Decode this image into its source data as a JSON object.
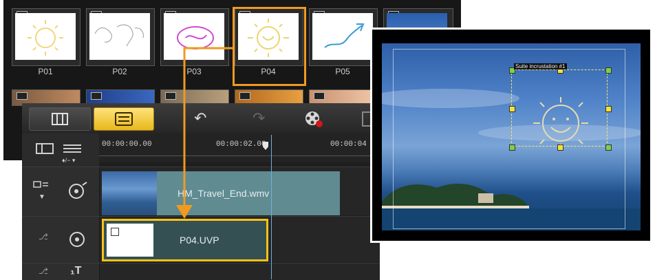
{
  "library": {
    "thumbs": [
      {
        "label": "P01"
      },
      {
        "label": "P02"
      },
      {
        "label": "P03"
      },
      {
        "label": "P04"
      },
      {
        "label": "P05"
      }
    ]
  },
  "toolbar": {
    "icons": [
      "storyboard-view-icon",
      "timeline-view-icon",
      "undo-icon",
      "redo-icon",
      "record-capture-icon"
    ]
  },
  "ruler": {
    "ticks": [
      "00:00:00.00",
      "00:00:02.00",
      "00:00:04"
    ]
  },
  "timeline": {
    "video_clip": "HM_Travel_End.wmv",
    "overlay_clip": "P04.UVP",
    "add_menu": "♦/− ▾"
  },
  "preview": {
    "tag": "Suite incrustation #1"
  },
  "colors": {
    "highlight": "#f09a22",
    "selected_clip_border": "#f6c21a",
    "timeline_button": "#f2c83a"
  }
}
